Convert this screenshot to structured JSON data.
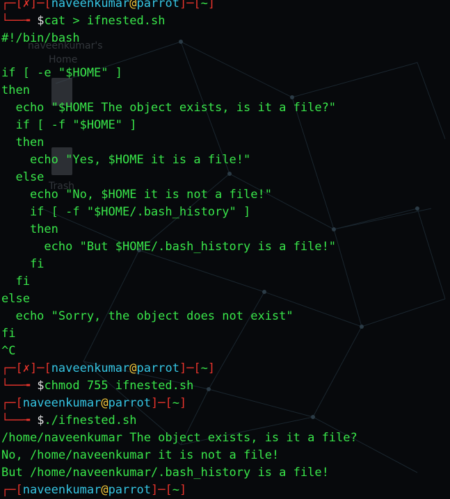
{
  "prompts": [
    {
      "status": "✗",
      "user": "naveenkumar",
      "at": "@",
      "host": "parrot",
      "dir": "~",
      "sym": "$",
      "cmd": "cat > ifnested.sh"
    },
    {
      "status": "✗",
      "user": "naveenkumar",
      "at": "@",
      "host": "parrot",
      "dir": "~",
      "sym": "$",
      "cmd": "chmod 755 ifnested.sh"
    },
    {
      "user": "naveenkumar",
      "at": "@",
      "host": "parrot",
      "dir": "~",
      "sym": "$",
      "cmd": "./ifnested.sh"
    },
    {
      "user": "naveenkumar",
      "at": "@",
      "host": "parrot",
      "dir": "~"
    }
  ],
  "script_lines": [
    "#!/bin/bash",
    "",
    "if [ -e \"$HOME\" ]",
    "then",
    "  echo \"$HOME The object exists, is it a file?\"",
    "  if [ -f \"$HOME\" ]",
    "  then",
    "    echo \"Yes, $HOME it is a file!\"",
    "  else",
    "    echo \"No, $HOME it is not a file!\"",
    "    if [ -f \"$HOME/.bash_history\" ]",
    "    then",
    "      echo \"But $HOME/.bash_history is a file!\"",
    "    fi",
    "  fi",
    "else",
    "  echo \"Sorry, the object does not exist\"",
    "fi",
    "^C"
  ],
  "output_lines": [
    "/home/naveenkumar The object exists, is it a file?",
    "No, /home/naveenkumar it is not a file!",
    "But /home/naveenkumar/.bash_history is a file!"
  ],
  "desktop": {
    "home_label_1": "naveenkumar's",
    "home_label_2": "Home",
    "trash_label": "Trash"
  },
  "colors": {
    "bracket": "#e8342c",
    "user": "#35c5e3",
    "at": "#f0c53a",
    "text": "#39e64a",
    "status": "#e8342c"
  }
}
